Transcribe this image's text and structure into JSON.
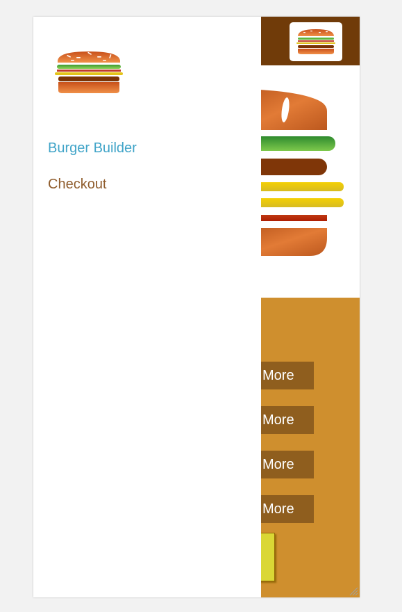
{
  "app": {
    "colors": {
      "toolbar": "#703b09",
      "controls_bg": "#cf8f2e",
      "more_button": "#8f5e1e",
      "order_button": "#dad735",
      "nav_active": "#40a4c8",
      "nav_default": "#8f5c2c"
    }
  },
  "side_drawer": {
    "logo_icon": "burger-logo-icon",
    "nav": [
      {
        "label": "Burger Builder",
        "active": true
      },
      {
        "label": "Checkout",
        "active": false
      }
    ]
  },
  "toolbar": {
    "logo_icon": "burger-logo-icon"
  },
  "build_controls": {
    "more_buttons": [
      {
        "label": "More"
      },
      {
        "label": "More"
      },
      {
        "label": "More"
      },
      {
        "label": "More"
      }
    ]
  }
}
